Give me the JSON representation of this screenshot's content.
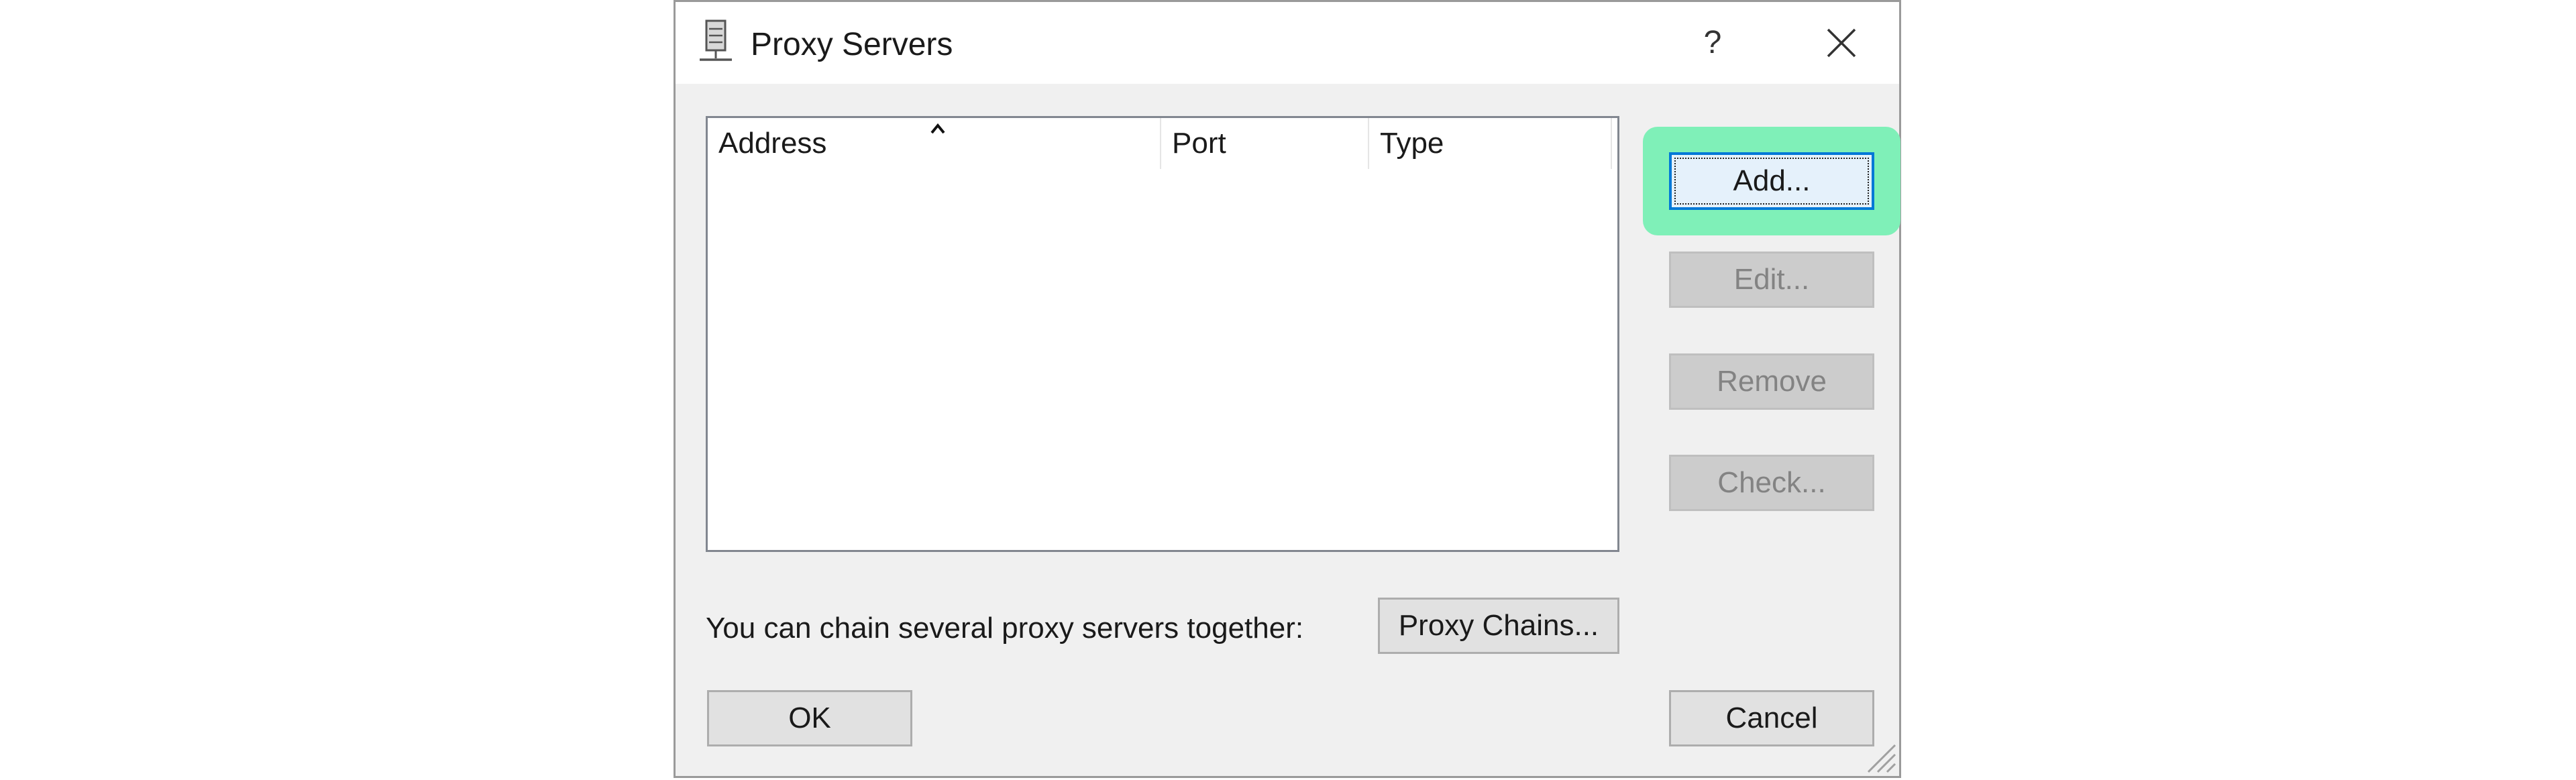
{
  "window": {
    "title": "Proxy Servers",
    "help_label": "?",
    "title_icon": "server-icon",
    "close_icon": "close-icon"
  },
  "list": {
    "columns": [
      {
        "label": "Address",
        "sorted": "ascending"
      },
      {
        "label": "Port"
      },
      {
        "label": "Type"
      }
    ],
    "rows": []
  },
  "side_buttons": {
    "add": "Add...",
    "edit": "Edit...",
    "remove": "Remove",
    "check": "Check..."
  },
  "chain": {
    "label": "You can chain several proxy servers together:",
    "button": "Proxy Chains..."
  },
  "footer": {
    "ok": "OK",
    "cancel": "Cancel"
  },
  "colors": {
    "focus_highlight": "#7ff0b8",
    "dialog_bg": "#f0f0f0",
    "accent": "#0078d7"
  }
}
